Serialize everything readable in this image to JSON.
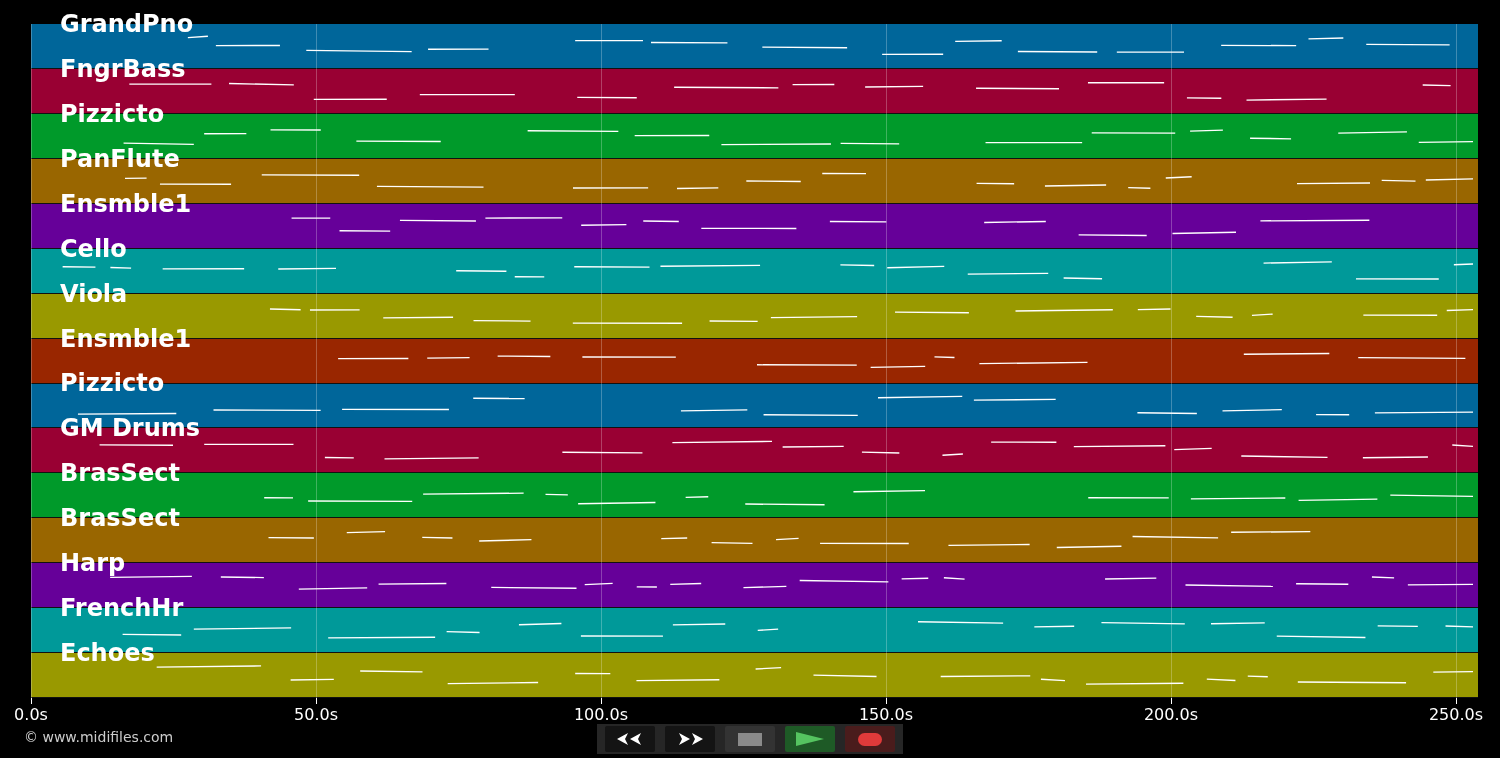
{
  "tracks": [
    {
      "name": "GrandPno",
      "color": "#00669a"
    },
    {
      "name": "FngrBass",
      "color": "#990033"
    },
    {
      "name": "Pizzicto",
      "color": "#009a2a"
    },
    {
      "name": "PanFlute",
      "color": "#996600"
    },
    {
      "name": "Ensmble1",
      "color": "#660099"
    },
    {
      "name": "Cello",
      "color": "#009999"
    },
    {
      "name": "Viola",
      "color": "#999900"
    },
    {
      "name": "Ensmble1",
      "color": "#992600"
    },
    {
      "name": "Pizzicto",
      "color": "#00669a"
    },
    {
      "name": "GM Drums",
      "color": "#990033"
    },
    {
      "name": "BrasSect",
      "color": "#009a2a"
    },
    {
      "name": "BrasSect",
      "color": "#996600"
    },
    {
      "name": "Harp",
      "color": "#660099"
    },
    {
      "name": "FrenchHr",
      "color": "#009999"
    },
    {
      "name": "Echoes",
      "color": "#999900"
    }
  ],
  "time_axis": [
    {
      "label": "0.0s"
    },
    {
      "label": "50.0s"
    },
    {
      "label": "100.0s"
    },
    {
      "label": "150.0s"
    },
    {
      "label": "200.0s"
    },
    {
      "label": "250.0s"
    }
  ],
  "transport": [
    {
      "kind": "rewind"
    },
    {
      "kind": "forward"
    },
    {
      "kind": "stop"
    },
    {
      "kind": "play"
    },
    {
      "kind": "record"
    }
  ],
  "credit": "© www.midifiles.com"
}
